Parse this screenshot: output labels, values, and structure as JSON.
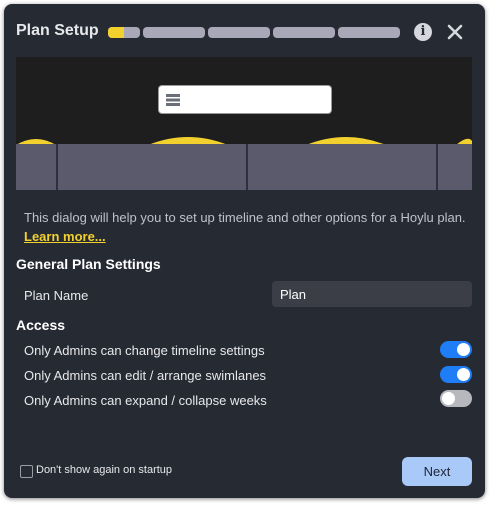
{
  "dialog": {
    "title": "Plan Setup",
    "progress": {
      "step": 1,
      "total_steps": 5,
      "current_step_fill_fraction": 0.5
    },
    "info_icon": "info-icon",
    "close_icon": "close-icon",
    "colors": {
      "background": "#262a33",
      "accent_yellow": "#f2d12e",
      "toggle_on": "#1f7ef5",
      "toggle_off": "#b7b8be",
      "next_button": "#a9c9f8"
    }
  },
  "preview": {
    "menu_icon": "list-icon"
  },
  "description": {
    "text": "This dialog will help you to set up timeline and other options for a Hoylu plan.",
    "link_label": "Learn more..."
  },
  "general": {
    "heading": "General Plan Settings",
    "plan_name_label": "Plan Name",
    "plan_name_value": "Plan"
  },
  "access": {
    "heading": "Access",
    "options": [
      {
        "label": "Only Admins can change timeline settings",
        "enabled": true
      },
      {
        "label": "Only Admins can edit / arrange swimlanes",
        "enabled": true
      },
      {
        "label": "Only Admins can expand / collapse weeks",
        "enabled": false
      }
    ]
  },
  "footer": {
    "dont_show_label": "Don't show again on startup",
    "dont_show_checked": false,
    "next_label": "Next"
  }
}
